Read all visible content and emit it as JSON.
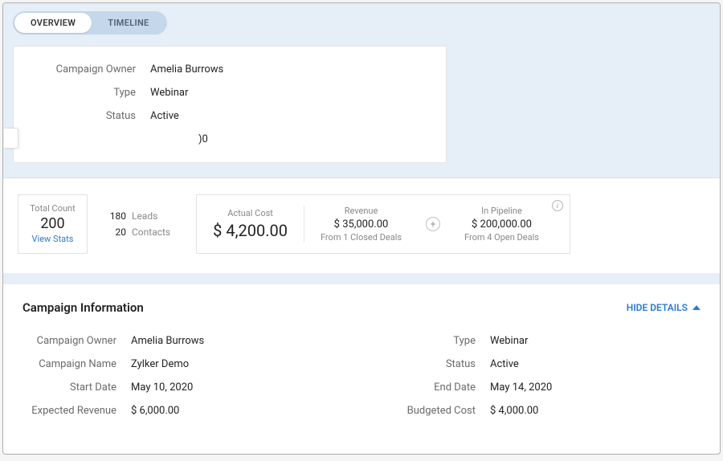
{
  "tabs": {
    "overview": "OVERVIEW",
    "timeline": "TIMELINE"
  },
  "summary": {
    "owner_label": "Campaign Owner",
    "owner_value": "Amelia Burrows",
    "type_label": "Type",
    "type_value": "Webinar",
    "status_label": "Status",
    "status_value": "Active",
    "extra_value": ")0"
  },
  "metrics": {
    "total_count_label": "Total Count",
    "total_count_value": "200",
    "view_stats": "View Stats",
    "leads_num": "180",
    "leads_label": "Leads",
    "contacts_num": "20",
    "contacts_label": "Contacts",
    "actual_cost_label": "Actual Cost",
    "actual_cost_value": "$ 4,200.00",
    "revenue_label": "Revenue",
    "revenue_value": "$ 35,000.00",
    "revenue_sub": "From 1 Closed Deals",
    "pipeline_label": "In Pipeline",
    "pipeline_value": "$ 200,000.00",
    "pipeline_sub": "From 4 Open Deals"
  },
  "info": {
    "section_title": "Campaign Information",
    "hide_details": "HIDE DETAILS",
    "left": {
      "owner_label": "Campaign Owner",
      "owner_value": "Amelia Burrows",
      "name_label": "Campaign Name",
      "name_value": "Zylker Demo",
      "start_label": "Start Date",
      "start_value": "May 10, 2020",
      "exprev_label": "Expected Revenue",
      "exprev_value": "$ 6,000.00"
    },
    "right": {
      "type_label": "Type",
      "type_value": "Webinar",
      "status_label": "Status",
      "status_value": "Active",
      "end_label": "End Date",
      "end_value": "May 14, 2020",
      "budget_label": "Budgeted Cost",
      "budget_value": "$ 4,000.00"
    }
  }
}
